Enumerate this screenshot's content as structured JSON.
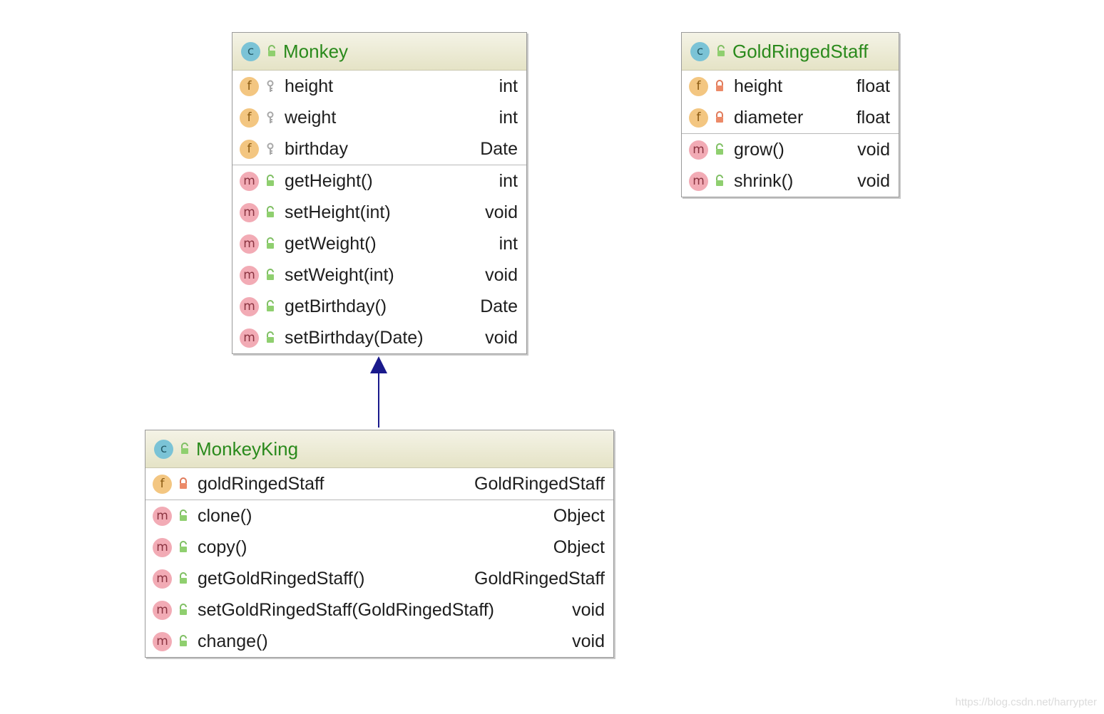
{
  "classes": {
    "monkey": {
      "name": "Monkey",
      "fields": [
        {
          "name": "height",
          "type": "int"
        },
        {
          "name": "weight",
          "type": "int"
        },
        {
          "name": "birthday",
          "type": "Date"
        }
      ],
      "methods": [
        {
          "name": "getHeight()",
          "type": "int"
        },
        {
          "name": "setHeight(int)",
          "type": "void"
        },
        {
          "name": "getWeight()",
          "type": "int"
        },
        {
          "name": "setWeight(int)",
          "type": "void"
        },
        {
          "name": "getBirthday()",
          "type": "Date"
        },
        {
          "name": "setBirthday(Date)",
          "type": "void"
        }
      ]
    },
    "goldRingedStaff": {
      "name": "GoldRingedStaff",
      "fields": [
        {
          "name": "height",
          "type": "float"
        },
        {
          "name": "diameter",
          "type": "float"
        }
      ],
      "methods": [
        {
          "name": "grow()",
          "type": "void"
        },
        {
          "name": "shrink()",
          "type": "void"
        }
      ]
    },
    "monkeyKing": {
      "name": "MonkeyKing",
      "fields": [
        {
          "name": "goldRingedStaff",
          "type": "GoldRingedStaff"
        }
      ],
      "methods": [
        {
          "name": "clone()",
          "type": "Object"
        },
        {
          "name": "copy()",
          "type": "Object"
        },
        {
          "name": "getGoldRingedStaff()",
          "type": "GoldRingedStaff"
        },
        {
          "name": "setGoldRingedStaff(GoldRingedStaff)",
          "type": "void"
        },
        {
          "name": "change()",
          "type": "void"
        }
      ]
    }
  },
  "badges": {
    "class": "c",
    "field": "f",
    "method": "m"
  },
  "relationships": [
    {
      "type": "inheritance",
      "from": "MonkeyKing",
      "to": "Monkey",
      "color": "#1a1a8c"
    }
  ],
  "icons": {
    "class_visibility": "public-unlock-icon",
    "monkey_fields_visibility": "package-key-icon",
    "private_fields_visibility": "private-lock-icon",
    "methods_visibility": "public-unlock-icon"
  },
  "colors": {
    "class_name": "#2a8a1c",
    "header_bg": "#e5e3c6",
    "arrow": "#1a1a8c"
  },
  "watermark": "https://blog.csdn.net/harrypter"
}
